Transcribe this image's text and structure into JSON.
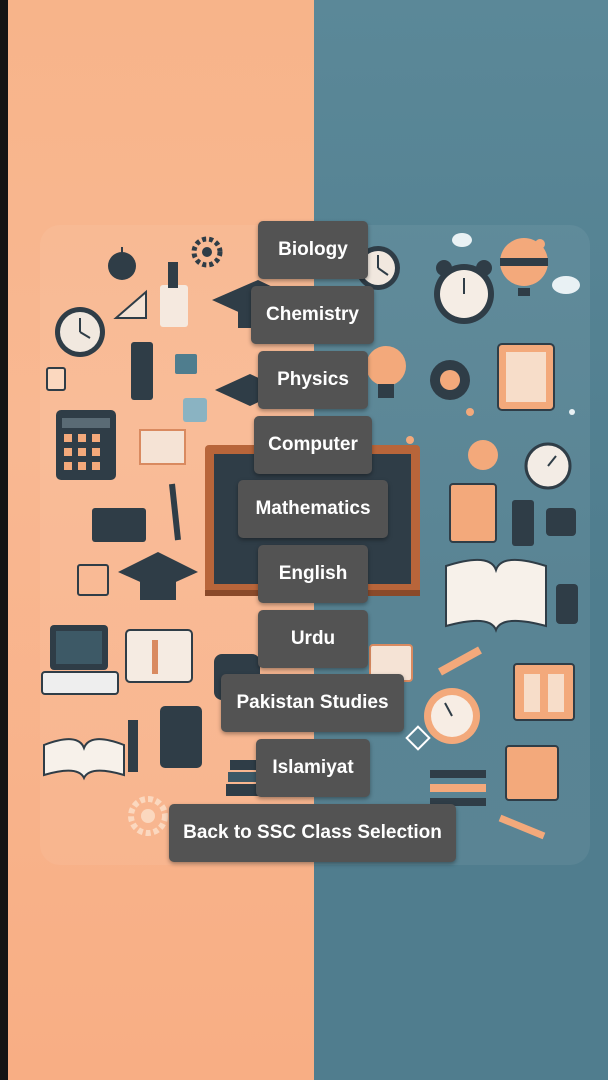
{
  "subjects": {
    "biology_label": "Biology",
    "chemistry_label": "Chemistry",
    "physics_label": "Physics",
    "computer_label": "Computer",
    "mathematics_label": "Mathematics",
    "english_label": "English",
    "urdu_label": "Urdu",
    "pakistan_studies_label": "Pakistan Studies",
    "islamiyat_label": "Islamiyat"
  },
  "navigation": {
    "back_label": "Back to SSC Class Selection"
  },
  "background": {
    "left_color": "#f7b48a",
    "right_color": "#52808f",
    "button_color": "#535353",
    "button_text_color": "#ffffff",
    "illustration_icons": [
      "apple-icon",
      "gear-icon",
      "clock-icon",
      "alarm-clock-icon",
      "lightbulb-icon",
      "calculator-icon",
      "graduation-cap-icon",
      "chalkboard-icon",
      "open-book-icon",
      "laptop-icon",
      "pencil-icon",
      "ruler-icon",
      "hot-air-balloon-icon",
      "cloud-icon",
      "notebook-icon",
      "phone-icon",
      "stopwatch-icon",
      "flask-icon"
    ]
  }
}
